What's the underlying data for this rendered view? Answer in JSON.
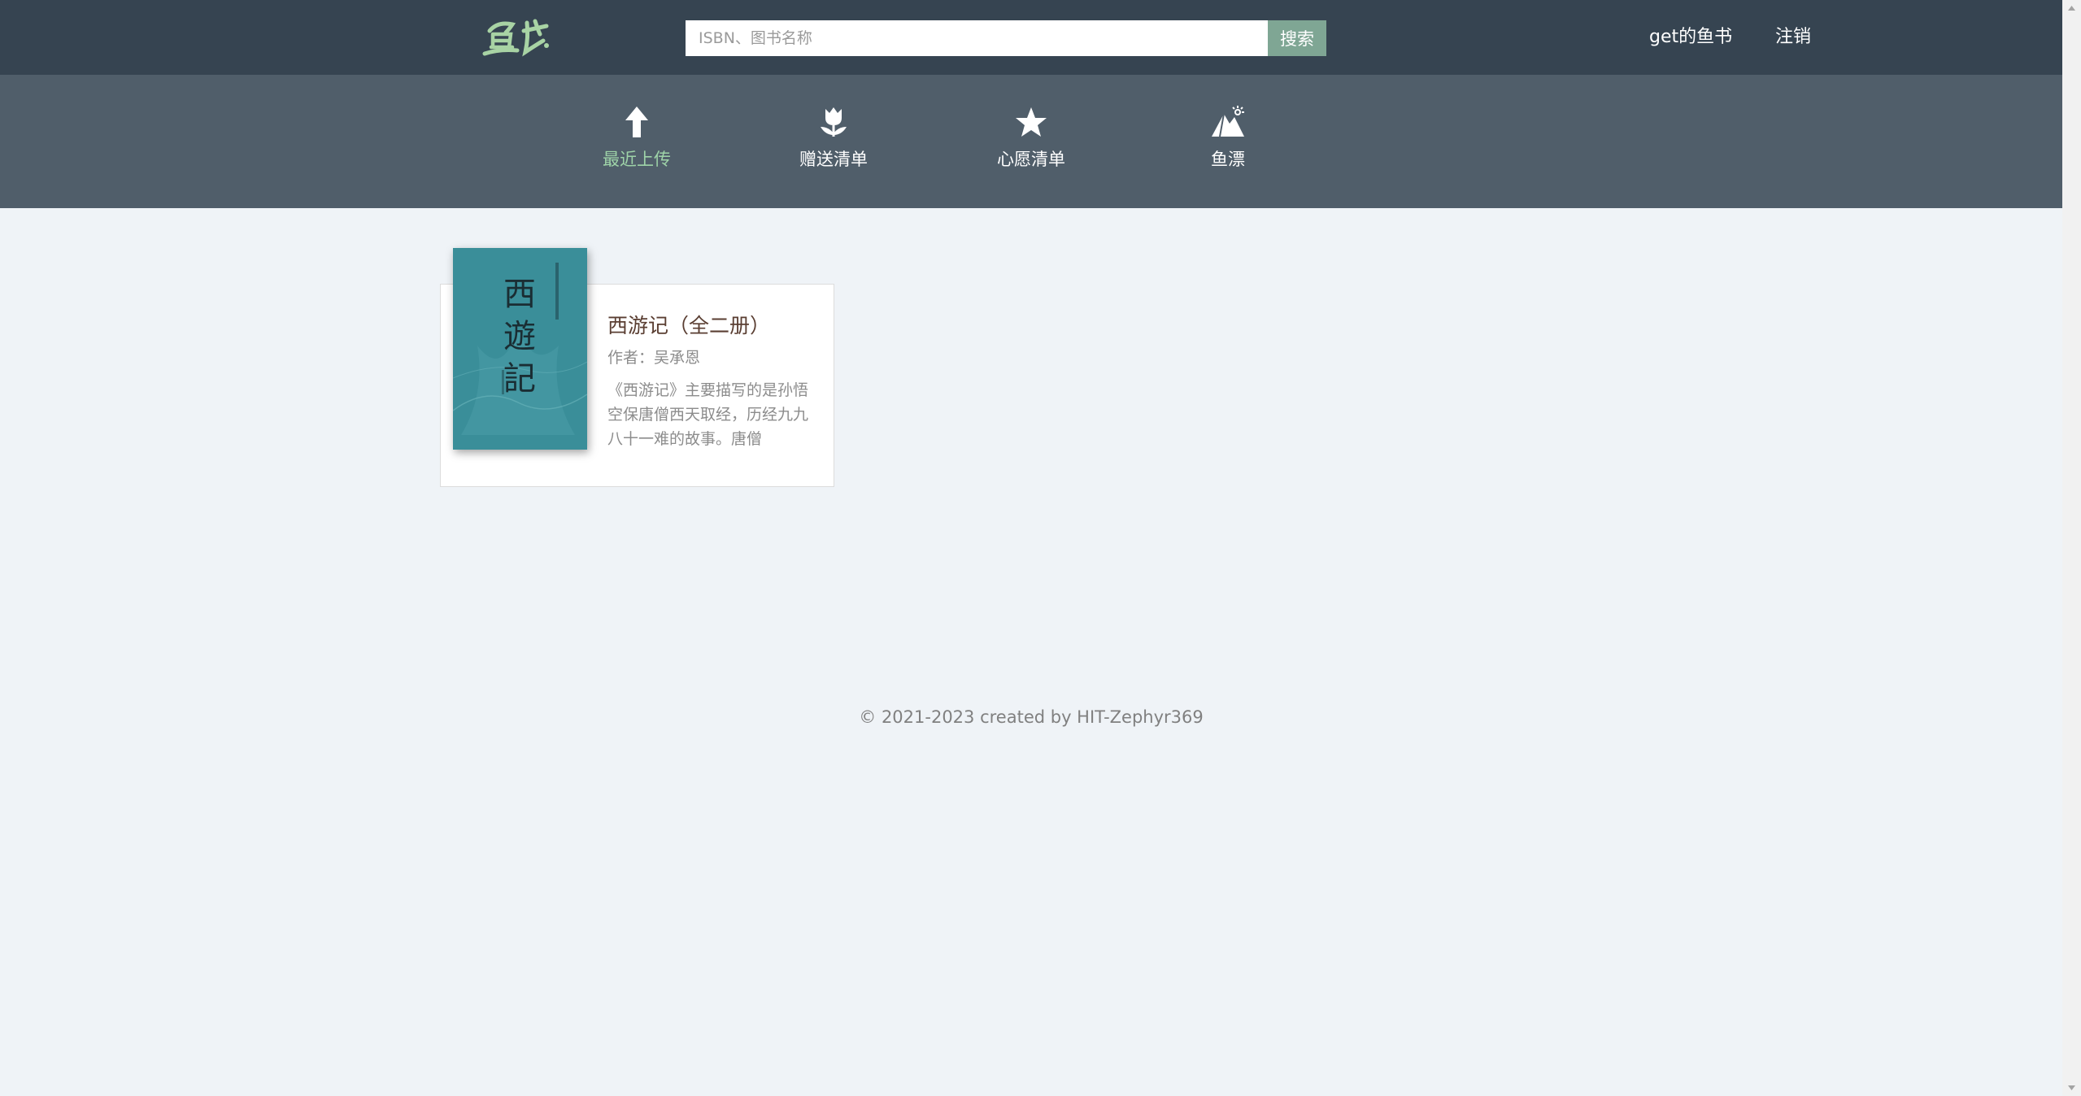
{
  "header": {
    "logo_text": "鱼书",
    "search_placeholder": "ISBN、图书名称",
    "search_button": "搜索",
    "my_books_link": "get的鱼书",
    "logout_link": "注销"
  },
  "categories": [
    {
      "label": "最近上传",
      "icon": "arrow-up-icon",
      "active": true
    },
    {
      "label": "赠送清单",
      "icon": "tulip-icon",
      "active": false
    },
    {
      "label": "心愿清单",
      "icon": "star-icon",
      "active": false
    },
    {
      "label": "鱼漂",
      "icon": "mountain-icon",
      "active": false
    }
  ],
  "books": [
    {
      "title": "西游记（全二册）",
      "author": "作者：吴承恩",
      "summary": "《西游记》主要描写的是孙悟空保唐僧西天取经，历经九九八十一难的故事。唐僧",
      "cover_title": "西遊記",
      "cover_color": "#3a8e99"
    }
  ],
  "footer": {
    "copyright": "© 2021-2023 created by HIT-Zephyr369"
  },
  "colors": {
    "header_bg": "#364451",
    "category_bar_bg": "#505e6a",
    "page_bg": "#eff3f7",
    "accent_green": "#7fa694",
    "active_tab_text": "#9ed3a8"
  }
}
